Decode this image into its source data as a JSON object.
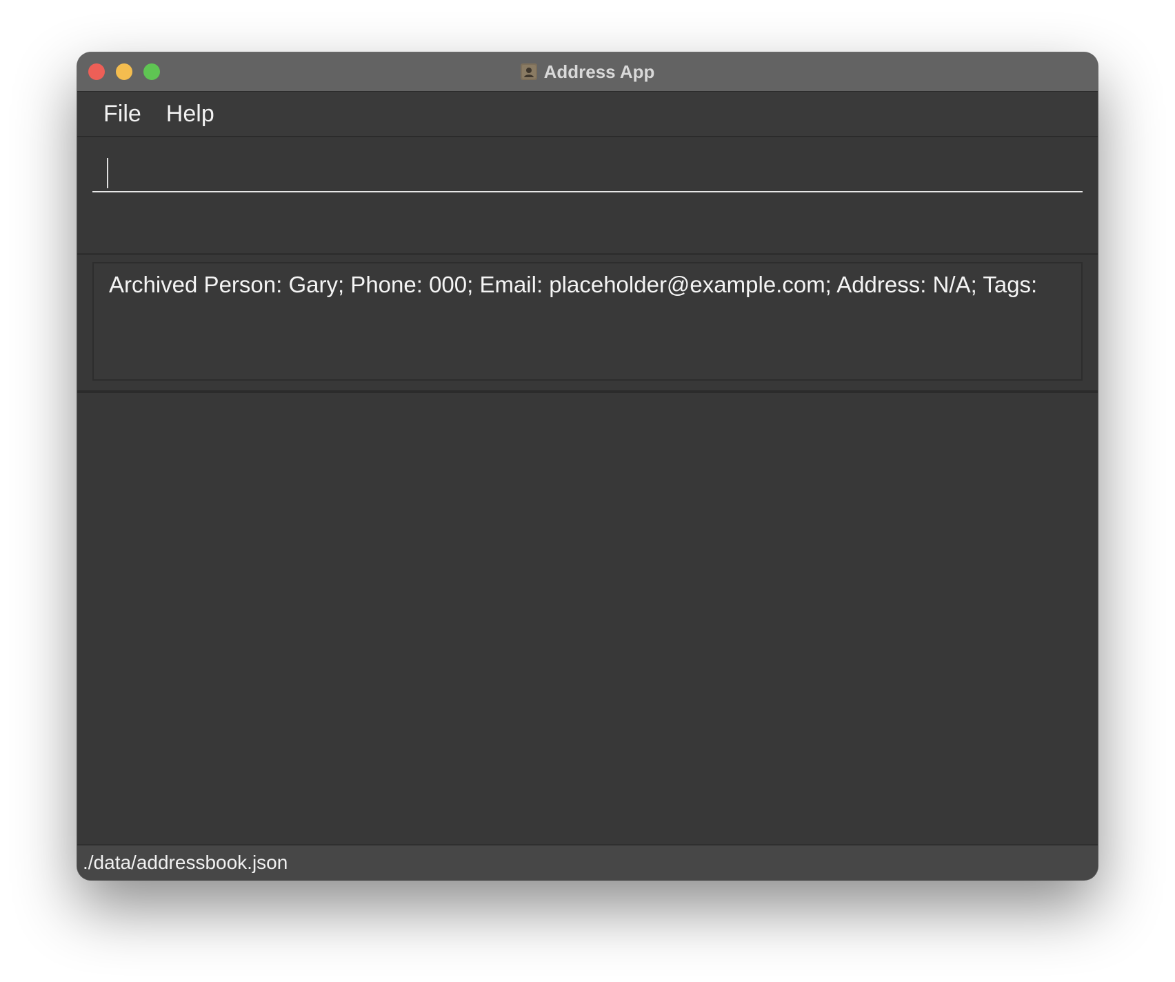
{
  "window": {
    "title": "Address App"
  },
  "menu": {
    "items": [
      {
        "label": "File"
      },
      {
        "label": "Help"
      }
    ]
  },
  "command": {
    "value": "",
    "placeholder": ""
  },
  "result": {
    "text": "Archived Person: Gary; Phone: 000; Email: placeholder@example.com; Address: N/A; Tags:"
  },
  "status": {
    "path": "./data/addressbook.json"
  },
  "colors": {
    "close": "#ee5f57",
    "minimize": "#f4bd4f",
    "maximize": "#5fc553",
    "background": "#383838"
  }
}
